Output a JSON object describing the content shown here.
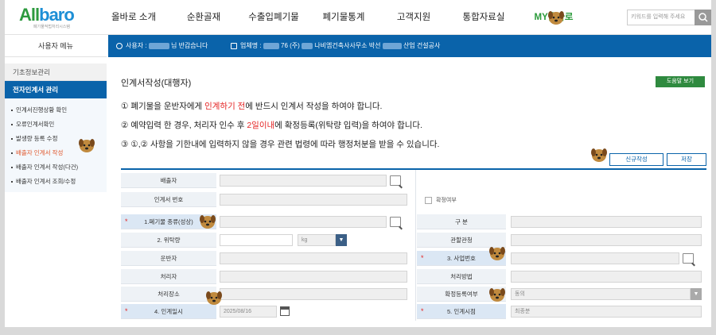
{
  "logo": {
    "main_a": "All",
    "main_b": "baro",
    "sub": "폐기물적법처리시스템"
  },
  "nav": {
    "items": [
      "올바로 소개",
      "순환골재",
      "수출입폐기물",
      "폐기물통계",
      "고객지원",
      "통합자료실",
      "MY올바로"
    ],
    "search_placeholder": "키워드를 입력해 주세요"
  },
  "userbar": {
    "user_label": "사용자 :",
    "user_suffix": "님 반갑습니다",
    "company_label": "업체명 :",
    "company_mid": "76 (주)",
    "company_tail": "나비엠건축사사무소 박선",
    "company_end": "산업 건설공사"
  },
  "sidebar": {
    "title": "사용자 메뉴",
    "section": "기초정보관리",
    "active": "전자인계서 관리",
    "items": [
      "인계서진행상황 확인",
      "오류인계서확인",
      "발생량 등록 수정",
      "배출자 인계서 작성",
      "배출자 인계서 작성(다건)",
      "배출자 인계서 조회/수정"
    ]
  },
  "main": {
    "title": "인계서작성(대행자)",
    "help_button": "도움말 보기",
    "notice1_a": "① 폐기물을 운반자에게 ",
    "notice1_b": "인계하기 전",
    "notice1_c": "에 반드시 인계서 작성을 하여야 합니다.",
    "notice2_a": "② 예약입력 한 경우, 처리자 인수 후 ",
    "notice2_b": "2일이내",
    "notice2_c": "에 확정등록(위탁량 입력)을 하여야 합니다.",
    "notice3": "③ ①,② 사항을 기한내에 입력하지 않을 경우 관련 법령에 따라 행정처분을 받을 수 있습니다.",
    "new_button": "신규작성",
    "save_button": "저장"
  },
  "form": {
    "emitter": "배출자",
    "handover_no": "인계서 번호",
    "confirmed": "확정여부",
    "waste_type": "1.폐기물 종류(성상)",
    "category": "구 분",
    "quantity": "2. 위탁량",
    "unit": "kg",
    "jurisdiction": "관할관청",
    "transporter": "운반자",
    "biz_no": "3. 사업번호",
    "processor": "처리자",
    "method": "처리방법",
    "place": "처리장소",
    "confirm_reg": "확정등록여부",
    "confirm_reg_value": "동의",
    "handover_date": "4. 인계일시",
    "date_value": "2025/08/16",
    "handover_time": "5. 인계시점",
    "time_value": "최종분"
  },
  "colors": {
    "brand_blue": "#0a63aa",
    "brand_green": "#2f8a3f",
    "accent_red": "#e42424"
  }
}
